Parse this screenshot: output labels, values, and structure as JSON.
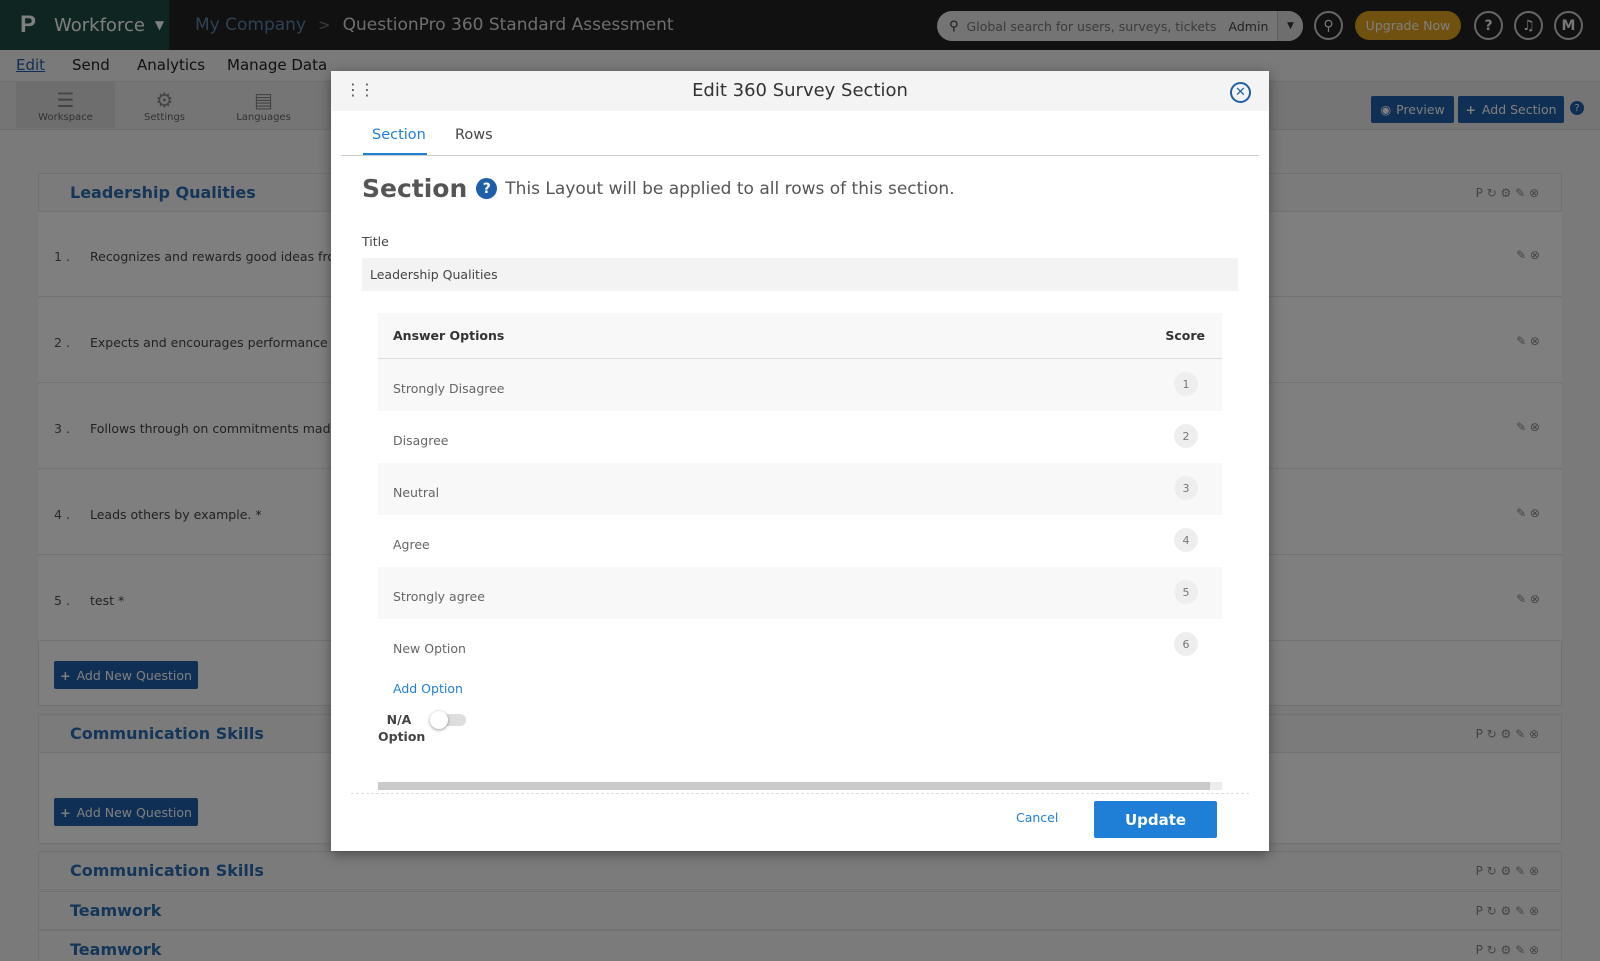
{
  "topbar": {
    "logo": "P",
    "app_name": "Workforce",
    "breadcrumb_company": "My Company",
    "breadcrumb_separator": ">",
    "breadcrumb_title": "QuestionPro 360 Standard Assessment",
    "search_placeholder": "Global search for users, surveys, tickets",
    "search_scope": "Admin",
    "upgrade_label": "Upgrade Now",
    "help_label": "?",
    "avatar_initial": "M"
  },
  "menu": {
    "items": [
      "Edit",
      "Send",
      "Analytics",
      "Manage Data"
    ],
    "active": "Edit"
  },
  "toolbar": {
    "tools": [
      {
        "label": "Workspace",
        "icon": "list-icon"
      },
      {
        "label": "Settings",
        "icon": "gear-icon"
      },
      {
        "label": "Languages",
        "icon": "translate-icon"
      }
    ],
    "preview_label": "Preview",
    "add_section_label": "Add Section"
  },
  "sections": [
    {
      "title": "Leadership Qualities",
      "questions": [
        {
          "num": "1 .",
          "text": "Recognizes and rewards good ideas from c"
        },
        {
          "num": "2 .",
          "text": "Expects and encourages performance from"
        },
        {
          "num": "3 .",
          "text": "Follows through on commitments made. *"
        },
        {
          "num": "4 .",
          "text": "Leads others by example. *"
        },
        {
          "num": "5 .",
          "text": "test *"
        }
      ],
      "add_question_label": "Add New Question"
    },
    {
      "title": "Communication Skills",
      "add_question_label": "Add New Question"
    },
    {
      "title": "Communication Skills"
    },
    {
      "title": "Teamwork"
    },
    {
      "title": "Teamwork"
    }
  ],
  "modal": {
    "title": "Edit 360 Survey Section",
    "tabs": [
      "Section",
      "Rows"
    ],
    "active_tab": "Section",
    "heading": "Section",
    "heading_hint": "This Layout will be applied to all rows of this section.",
    "title_label": "Title",
    "title_value": "Leadership Qualities",
    "table_header_options": "Answer Options",
    "table_header_score": "Score",
    "options": [
      {
        "label": "Strongly Disagree",
        "score": "1"
      },
      {
        "label": "Disagree",
        "score": "2"
      },
      {
        "label": "Neutral",
        "score": "3"
      },
      {
        "label": "Agree",
        "score": "4"
      },
      {
        "label": "Strongly agree",
        "score": "5"
      },
      {
        "label": "New Option",
        "score": "6"
      }
    ],
    "add_option_label": "Add Option",
    "na_option_label_1": "N/A",
    "na_option_label_2": "Option",
    "na_option_enabled": false,
    "cancel_label": "Cancel",
    "update_label": "Update"
  },
  "colors": {
    "accent": "#1f7fd6",
    "brand": "#1d4b45",
    "upgrade": "#e2a21e",
    "primary_button": "#1f5fa8"
  }
}
